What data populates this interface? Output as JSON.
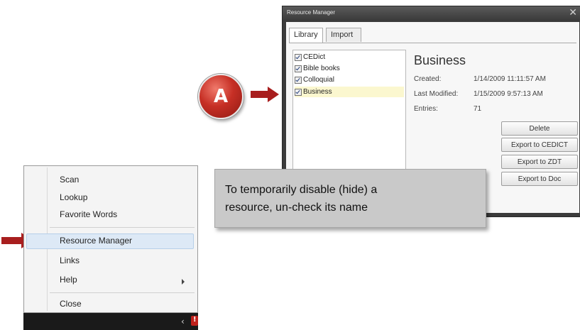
{
  "resource_manager": {
    "title": "Resource Manager",
    "close_glyph": "✕",
    "tabs": [
      {
        "label": "Library",
        "active": true
      },
      {
        "label": "Import",
        "active": false
      }
    ],
    "resources": [
      {
        "label": "CEDict",
        "checked": true,
        "selected": false
      },
      {
        "label": "Bible books",
        "checked": true,
        "selected": false
      },
      {
        "label": "Colloquial",
        "checked": true,
        "selected": false
      },
      {
        "label": "Business",
        "checked": true,
        "selected": true
      }
    ],
    "detail": {
      "title": "Business",
      "created_label": "Created:",
      "created_value": "1/14/2009 11:11:57 AM",
      "modified_label": "Last Modified:",
      "modified_value": "1/15/2009 9:57:13 AM",
      "entries_label": "Entries:",
      "entries_value": "71"
    },
    "buttons": {
      "delete": "Delete",
      "export_cedict": "Export to CEDICT",
      "export_zdt": "Export to ZDT",
      "export_doc": "Export to Doc"
    }
  },
  "context_menu": {
    "items": [
      "Scan",
      "Lookup",
      "Favorite Words",
      "Resource Manager",
      "Links",
      "Help",
      "Close"
    ],
    "selected_item": "Resource Manager"
  },
  "callouts": {
    "badge_letter": "A",
    "tooltip_line1": "To temporarily disable (hide) a",
    "tooltip_line2": "resource, un-check its name",
    "arrow_color": "#a81e1e"
  },
  "taskbar": {
    "expand_glyph": "‹"
  },
  "colors": {
    "selected_resource_bg": "#fbf7cf",
    "menu_highlight_bg": "#dde9f6",
    "badge_red": "#c62f25",
    "tooltip_bg": "#c9c9c9"
  }
}
